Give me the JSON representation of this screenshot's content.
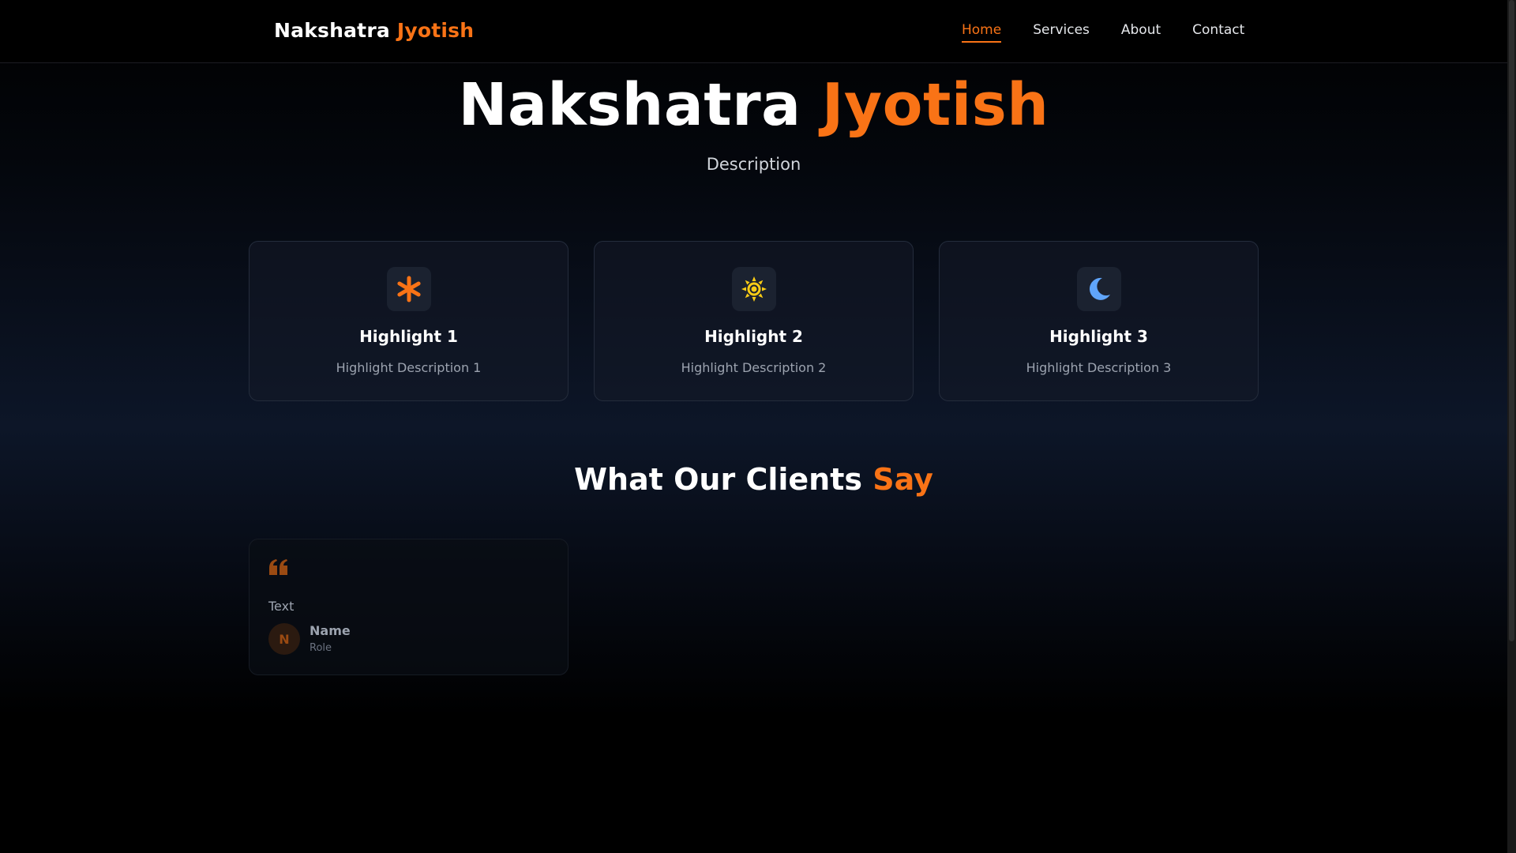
{
  "navbar": {
    "brand_part1": "Nakshatra",
    "brand_part2": "Jyotish",
    "links": [
      {
        "label": "Home",
        "active": true
      },
      {
        "label": "Services",
        "active": false
      },
      {
        "label": "About",
        "active": false
      },
      {
        "label": "Contact",
        "active": false
      }
    ]
  },
  "hero": {
    "title_part1": "Nakshatra",
    "title_part2": "Jyotish",
    "description": "Description"
  },
  "highlights": [
    {
      "icon": "asterisk-icon",
      "icon_color": "#f97316",
      "title": "Highlight 1",
      "description": "Highlight Description 1"
    },
    {
      "icon": "sun-icon",
      "icon_color": "#facc15",
      "title": "Highlight 2",
      "description": "Highlight Description 2"
    },
    {
      "icon": "moon-icon",
      "icon_color": "#60a5fa",
      "title": "Highlight 3",
      "description": "Highlight Description 3"
    }
  ],
  "testimonials_section": {
    "title_part1": "What Our Clients",
    "title_part2": "Say"
  },
  "testimonial": {
    "icon": "quote-icon",
    "text": "Text",
    "avatar_initial": "N",
    "name": "Name",
    "role": "Role"
  },
  "colors": {
    "accent": "#f97316",
    "background": "#000000",
    "card_border": "#242c3c"
  }
}
